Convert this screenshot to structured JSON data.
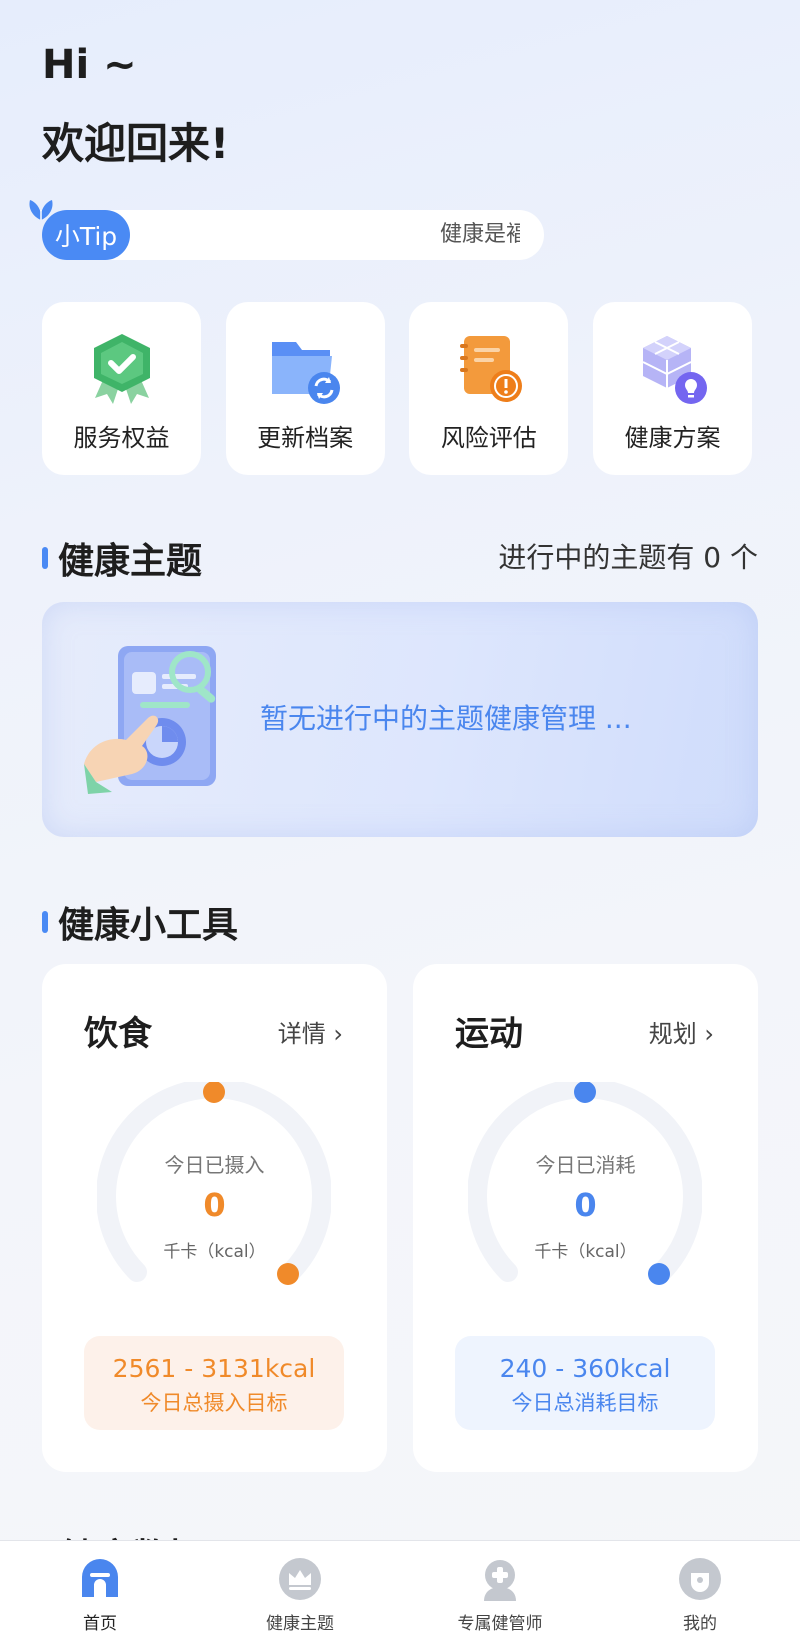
{
  "greeting": {
    "hi": "Hi ~",
    "welcome": "欢迎回来!"
  },
  "tip": {
    "badge": "小Tip",
    "text": "健康是褔"
  },
  "quick_actions": [
    {
      "label": "服务权益",
      "icon": "service-badge-icon"
    },
    {
      "label": "更新档案",
      "icon": "folder-refresh-icon"
    },
    {
      "label": "风险评估",
      "icon": "risk-notebook-icon"
    },
    {
      "label": "健康方案",
      "icon": "plan-cube-icon"
    }
  ],
  "health_topics": {
    "title": "健康主题",
    "status": "进行中的主题有 0 个",
    "empty_text": "暂无进行中的主题健康管理 ..."
  },
  "tools": {
    "title": "健康小工具",
    "diet": {
      "title": "饮食",
      "link": "详情 ›",
      "caption": "今日已摄入",
      "value": "0",
      "unit": "千卡（kcal）",
      "target_value": "2561 - 3131kcal",
      "target_caption": "今日总摄入目标",
      "color": "#f08a2a",
      "bg": "#fdf1ea"
    },
    "exercise": {
      "title": "运动",
      "link": "规划 ›",
      "caption": "今日已消耗",
      "value": "0",
      "unit": "千卡（kcal）",
      "target_value": "240 - 360kcal",
      "target_caption": "今日总消耗目标",
      "color": "#4a86ee",
      "bg": "#eef4fe"
    }
  },
  "next_section_peek": "健康数据",
  "tabbar": [
    {
      "label": "首页",
      "icon": "home-icon",
      "active": true
    },
    {
      "label": "健康主题",
      "icon": "crown-icon",
      "active": false
    },
    {
      "label": "专属健管师",
      "icon": "doctor-icon",
      "active": false
    },
    {
      "label": "我的",
      "icon": "profile-icon",
      "active": false
    }
  ]
}
